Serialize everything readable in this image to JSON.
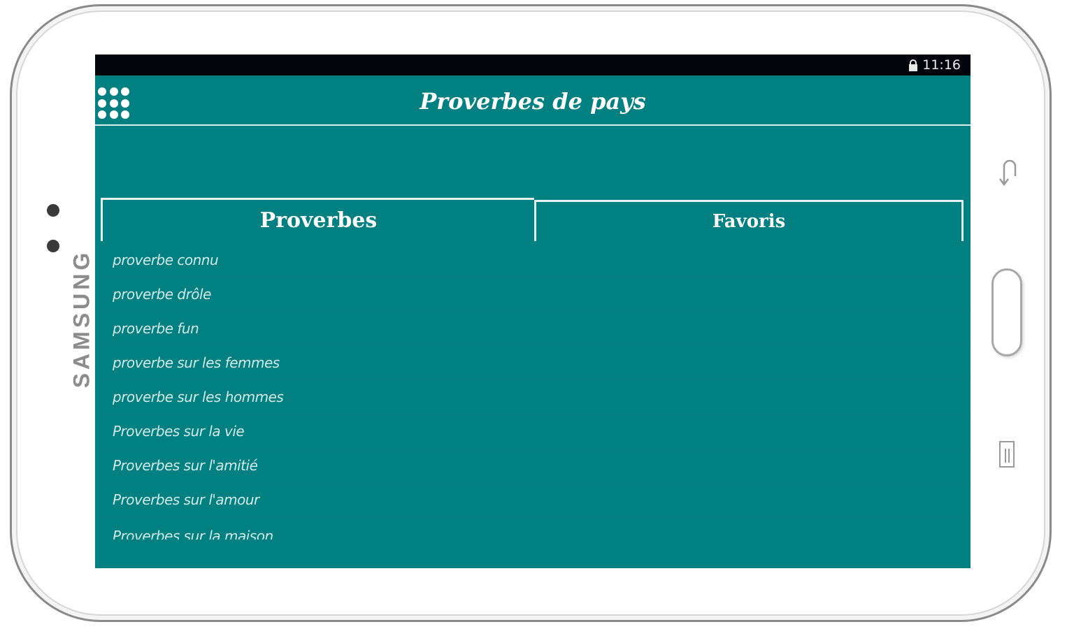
{
  "device": {
    "brand": "SAMSUNG"
  },
  "status_bar": {
    "time": "11:16"
  },
  "toolbar": {
    "title": "Proverbes de pays"
  },
  "tabs": [
    {
      "label": "Proverbes",
      "selected": true
    },
    {
      "label": "Favoris",
      "selected": false
    }
  ],
  "list": {
    "items": [
      {
        "label": "proverbe connu"
      },
      {
        "label": "proverbe drôle"
      },
      {
        "label": "proverbe fun"
      },
      {
        "label": "proverbe sur les femmes"
      },
      {
        "label": "proverbe sur les hommes"
      },
      {
        "label": "Proverbes sur la vie"
      },
      {
        "label": "Proverbes sur l'amitié"
      },
      {
        "label": "Proverbes sur l'amour"
      },
      {
        "label": "Proverbes sur la maison"
      }
    ]
  },
  "colors": {
    "primary": "#008080",
    "status_bar": "#03040a",
    "text": "#ffffff"
  },
  "icons": [
    "lock-icon",
    "apps-grid-icon",
    "back-icon",
    "menu-icon"
  ]
}
